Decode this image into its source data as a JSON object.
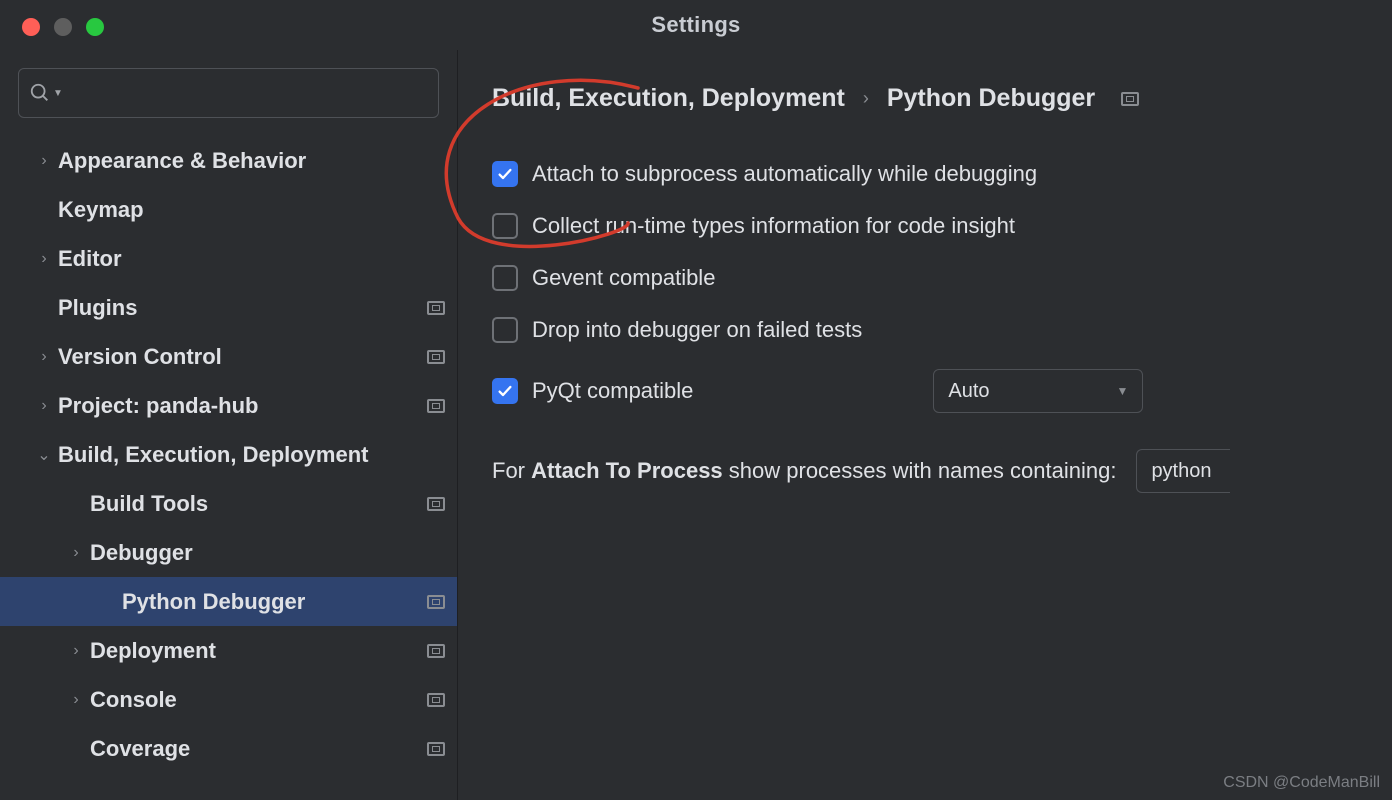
{
  "window": {
    "title": "Settings"
  },
  "search": {
    "placeholder": ""
  },
  "sidebar": {
    "items": [
      {
        "label": "Appearance & Behavior",
        "arrow": "right",
        "badge": false,
        "indent": 0
      },
      {
        "label": "Keymap",
        "arrow": "",
        "badge": false,
        "indent": 0
      },
      {
        "label": "Editor",
        "arrow": "right",
        "badge": false,
        "indent": 0
      },
      {
        "label": "Plugins",
        "arrow": "",
        "badge": true,
        "indent": 0
      },
      {
        "label": "Version Control",
        "arrow": "right",
        "badge": true,
        "indent": 0
      },
      {
        "label": "Project: panda-hub",
        "arrow": "right",
        "badge": true,
        "indent": 0
      },
      {
        "label": "Build, Execution, Deployment",
        "arrow": "down",
        "badge": false,
        "indent": 0
      },
      {
        "label": "Build Tools",
        "arrow": "",
        "badge": true,
        "indent": 1
      },
      {
        "label": "Debugger",
        "arrow": "right",
        "badge": false,
        "indent": 1
      },
      {
        "label": "Python Debugger",
        "arrow": "",
        "badge": true,
        "indent": 2,
        "selected": true
      },
      {
        "label": "Deployment",
        "arrow": "right",
        "badge": true,
        "indent": 1
      },
      {
        "label": "Console",
        "arrow": "right",
        "badge": true,
        "indent": 1
      },
      {
        "label": "Coverage",
        "arrow": "",
        "badge": true,
        "indent": 1
      }
    ]
  },
  "breadcrumbs": {
    "a": "Build, Execution, Deployment",
    "sep": "›",
    "b": "Python Debugger"
  },
  "options": {
    "attach_subprocess": {
      "label": "Attach to subprocess automatically while debugging",
      "checked": true
    },
    "collect_types": {
      "label": "Collect run-time types information for code insight",
      "checked": false
    },
    "gevent": {
      "label": "Gevent compatible",
      "checked": false
    },
    "drop_failed": {
      "label": "Drop into debugger on failed tests",
      "checked": false
    },
    "pyqt": {
      "label": "PyQt compatible",
      "checked": true,
      "select_value": "Auto"
    }
  },
  "attach_line": {
    "prefix": "For ",
    "bold": "Attach To Process",
    "suffix": " show processes with names containing:",
    "input_value": "python"
  },
  "watermark": "CSDN @CodeManBill"
}
